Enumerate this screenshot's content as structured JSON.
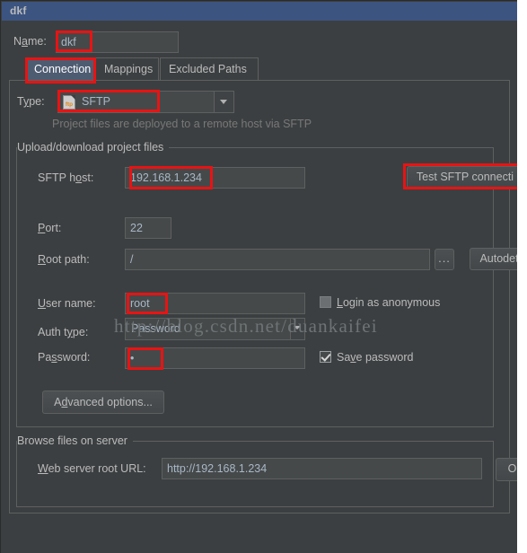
{
  "window": {
    "title": "dkf"
  },
  "form": {
    "name_label": "Name:",
    "name_value": "dkf"
  },
  "tabs": [
    {
      "label": "Connection",
      "active": true
    },
    {
      "label": "Mappings",
      "active": false
    },
    {
      "label": "Excluded Paths",
      "active": false
    }
  ],
  "type_row": {
    "label": "Type:",
    "value": "SFTP",
    "icon": "ftp-document-icon",
    "hint": "Project files are deployed to a remote host via SFTP"
  },
  "upload_group": {
    "title": "Upload/download project files",
    "sftp_host_label": "SFTP host:",
    "sftp_host_value": "192.168.1.234",
    "test_button_label": "Test SFTP connecti",
    "port_label": "Port:",
    "port_value": "22",
    "root_path_label": "Root path:",
    "root_path_value": "/",
    "browse_button_label": "...",
    "autodetect_button_label": "Autodet",
    "user_name_label": "User name:",
    "user_name_value": "root",
    "login_anonymous_label": "Login as anonymous",
    "login_anonymous_checked": false,
    "auth_type_label": "Auth type:",
    "auth_type_value": "Password",
    "password_label": "Password:",
    "password_value": "•",
    "save_password_label": "Save password",
    "save_password_checked": true,
    "advanced_button_label": "Advanced options..."
  },
  "browse_group": {
    "title": "Browse files on server",
    "web_url_label": "Web server root URL:",
    "web_url_value": "http://192.168.1.234",
    "open_button_label": "Op"
  },
  "watermark": {
    "text": "http://blog.csdn.net/duankaifei"
  },
  "colors": {
    "accent_titlebar": "#3c5480",
    "window_bg": "#3c3f41",
    "field_bg": "#45494a",
    "annotation_red": "#e81313",
    "tab_active": "#4e5c72",
    "text": "#bbbbbb"
  }
}
